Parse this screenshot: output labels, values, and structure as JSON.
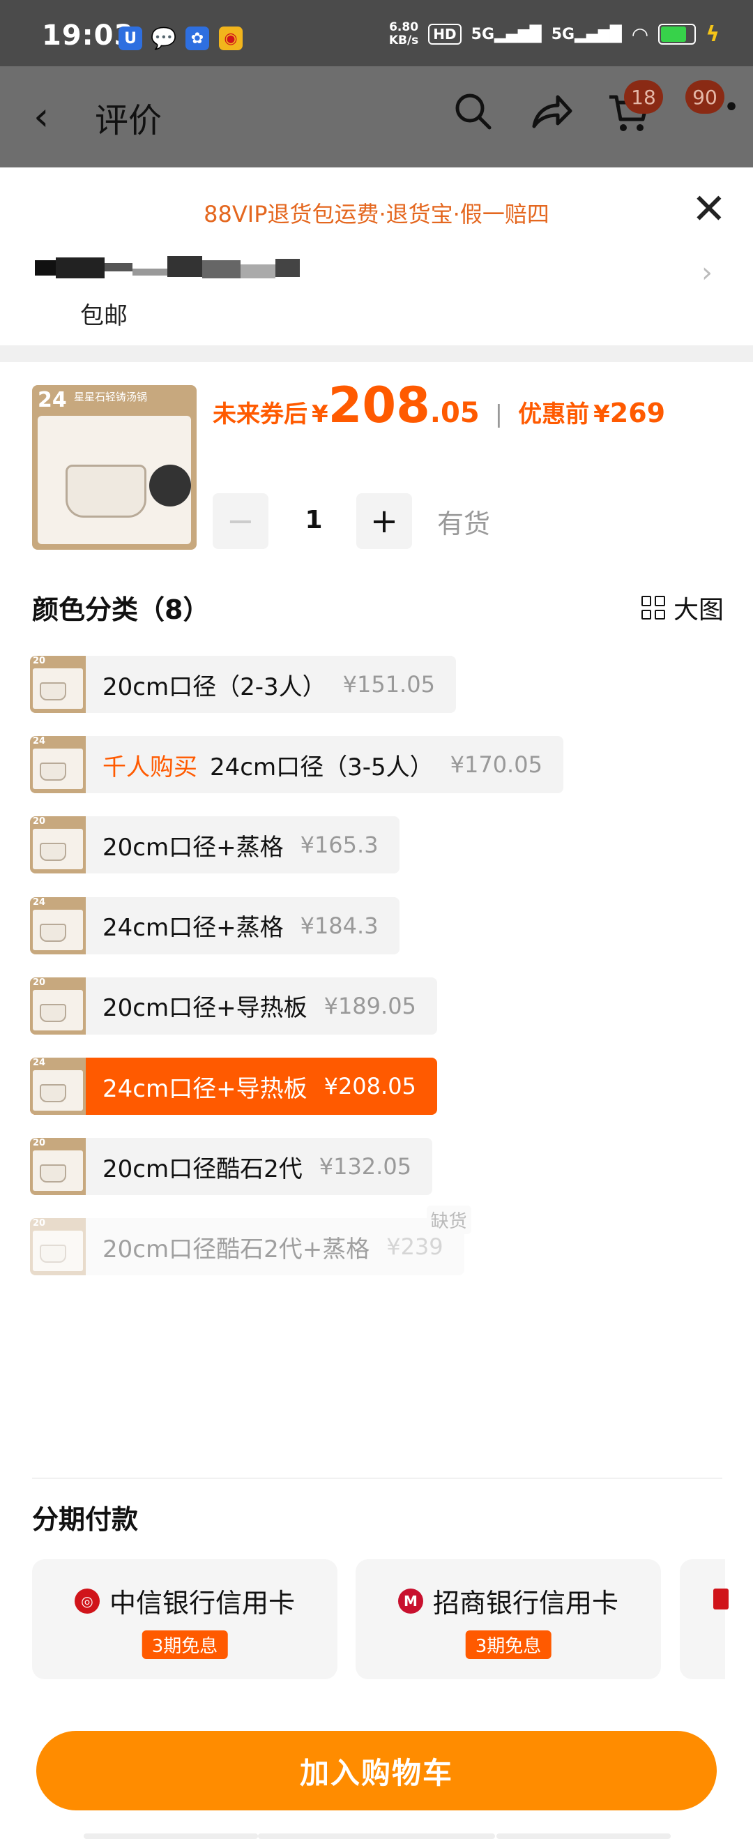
{
  "status_bar": {
    "time": "19:03",
    "speed_value": "6.80",
    "speed_unit": "KB/s",
    "hd_badge": "HD",
    "net1": "5G",
    "net2": "5G",
    "battery_level": 0.8,
    "colors": {
      "background": "#4b4b4b",
      "battery": "#37d24a",
      "charging": "#f5c518"
    }
  },
  "header": {
    "back_icon": "chevron-left",
    "title": "评价",
    "cart_badge": "18",
    "more_badge": "90"
  },
  "sheet": {
    "promo": "88VIP退货包运费·退货宝·假一赔四",
    "shipping": "包邮",
    "product": {
      "image_number": "24",
      "image_title": "星星石轻铸汤锅",
      "price_label": "未来券后",
      "currency": "¥",
      "price_int": "208",
      "price_dec": ".05",
      "before_label": "优惠前",
      "before_price": "269",
      "quantity": "1",
      "stock": "有货"
    },
    "color_section": {
      "title": "颜色分类（8）",
      "big_view": "大图"
    },
    "variants": [
      {
        "size": "20",
        "tag": "",
        "name": "20cm口径（2-3人）",
        "price": "¥151.05",
        "state": "normal"
      },
      {
        "size": "24",
        "tag": "千人购买",
        "name": "24cm口径（3-5人）",
        "price": "¥170.05",
        "state": "normal"
      },
      {
        "size": "20",
        "tag": "",
        "name": "20cm口径+蒸格",
        "price": "¥165.3",
        "state": "normal"
      },
      {
        "size": "24",
        "tag": "",
        "name": "24cm口径+蒸格",
        "price": "¥184.3",
        "state": "normal"
      },
      {
        "size": "20",
        "tag": "",
        "name": "20cm口径+导热板",
        "price": "¥189.05",
        "state": "normal"
      },
      {
        "size": "24",
        "tag": "",
        "name": "24cm口径+导热板",
        "price": "¥208.05",
        "state": "selected"
      },
      {
        "size": "20",
        "tag": "",
        "name": "20cm口径酷石2代",
        "price": "¥132.05",
        "state": "normal"
      },
      {
        "size": "20",
        "tag": "",
        "name": "20cm口径酷石2代+蒸格",
        "price": "¥239",
        "state": "out_of_stock",
        "badge": "缺货"
      }
    ],
    "installment": {
      "title": "分期付款",
      "cards": [
        {
          "bank": "中信银行信用卡",
          "offer": "3期免息",
          "logo_color": "#d0141a"
        },
        {
          "bank": "招商银行信用卡",
          "offer": "3期免息",
          "logo_color": "#c8102e"
        }
      ]
    },
    "add_to_cart": "加入购物车",
    "colors": {
      "accent": "#ff5a00",
      "promo": "#e4671f",
      "cta": "#ff8c00"
    }
  }
}
